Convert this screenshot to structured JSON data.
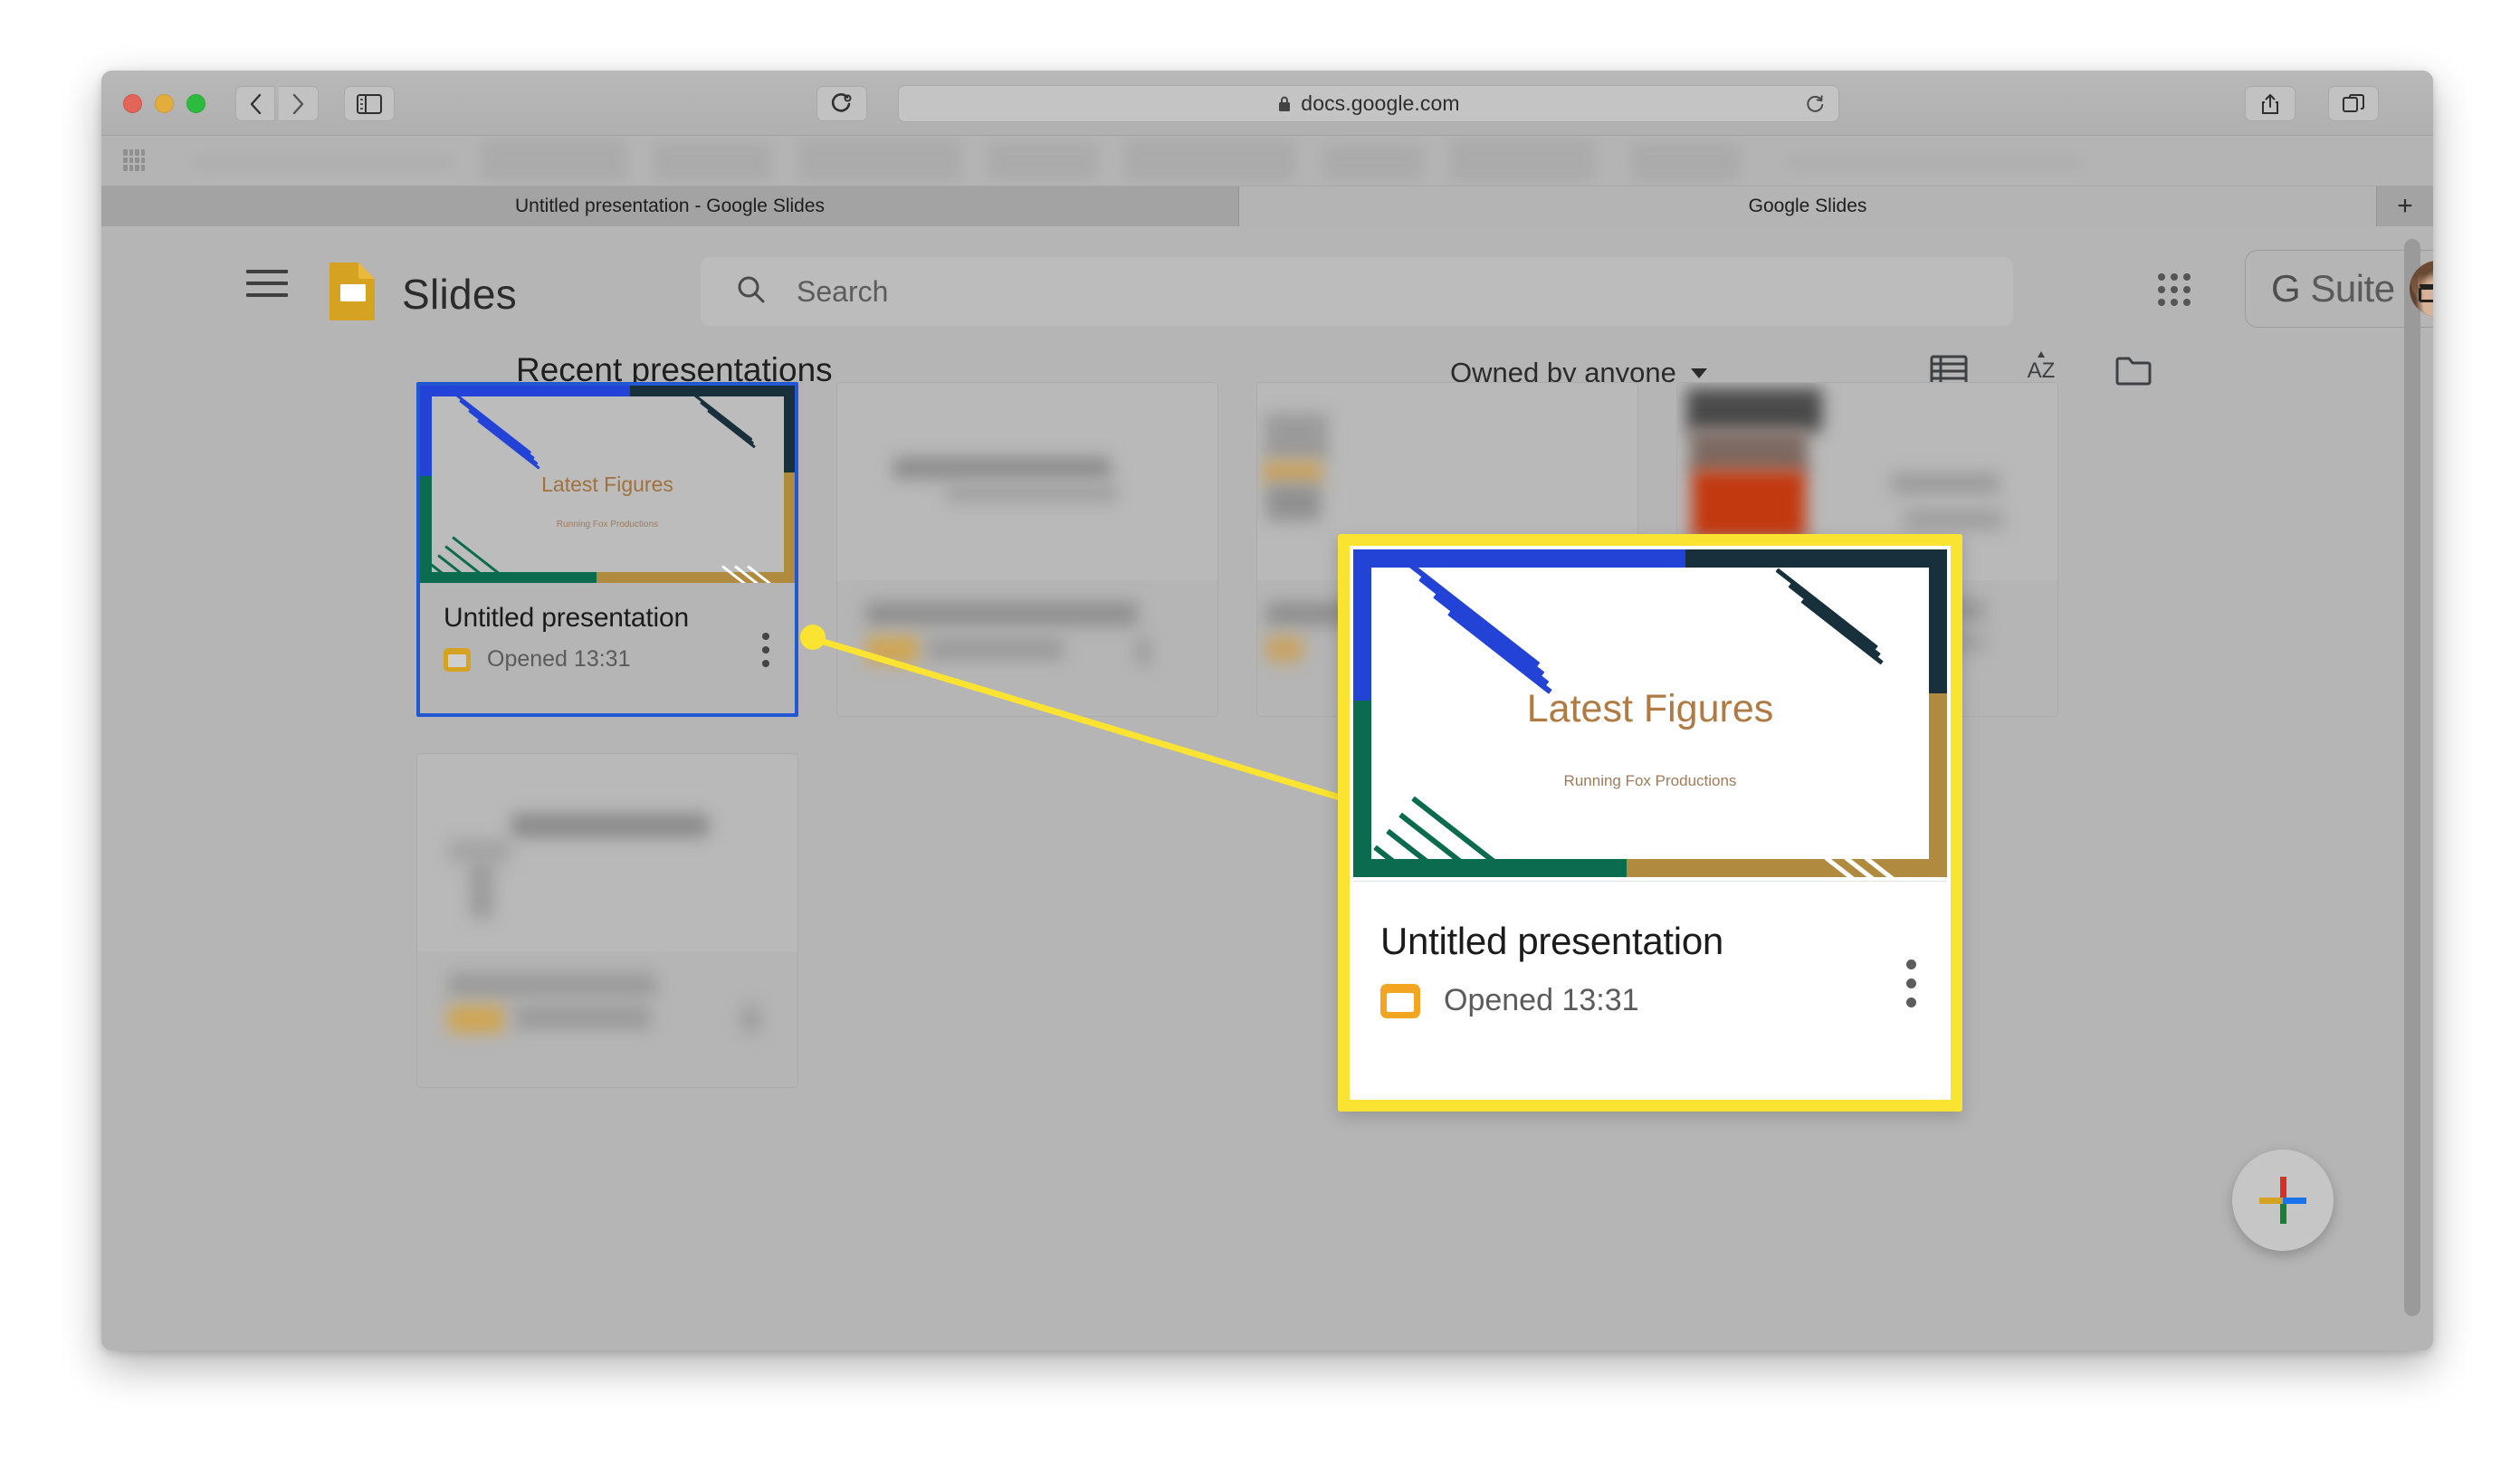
{
  "browser": {
    "url": "docs.google.com",
    "lock_icon": "lock-icon",
    "reload_icon": "reload-icon",
    "back_icon": "chevron-left-icon",
    "forward_icon": "chevron-right-icon",
    "sidebar_icon": "sidebar-toggle-icon",
    "reader_icon": "reader-view-icon",
    "share_icon": "share-icon",
    "tabs_icon": "show-all-tabs-icon",
    "new_tab_label": "+",
    "tabs": [
      {
        "label": "Untitled presentation - Google Slides",
        "active": false
      },
      {
        "label": "Google Slides",
        "active": true
      }
    ]
  },
  "app": {
    "name": "Slides",
    "menu_icon": "hamburger-menu-icon",
    "logo_icon": "google-slides-logo-icon",
    "apps_icon": "google-apps-grid-icon",
    "search": {
      "placeholder": "Search",
      "icon": "search-icon"
    },
    "account": {
      "badge_g": "G",
      "badge_text": "Suite",
      "avatar": "user-avatar"
    }
  },
  "section": {
    "title": "Recent presentations",
    "owner_filter": "Owned by anyone",
    "owner_filter_caret": "chevron-down-icon",
    "tools": [
      {
        "name": "list-view-icon"
      },
      {
        "name": "sort-az-icon"
      },
      {
        "name": "file-picker-folder-icon"
      }
    ]
  },
  "presentations": [
    {
      "title": "Untitled presentation",
      "opened": "Opened 13:31",
      "slide_title": "Latest Figures",
      "slide_subtitle": "Running Fox Productions",
      "selected": true,
      "type_icon": "slides-file-icon",
      "menu_icon": "more-options-kebab-icon"
    },
    {
      "title": "",
      "opened": "",
      "blurred": true
    },
    {
      "title": "",
      "opened": "",
      "blurred": true
    },
    {
      "title": "",
      "opened": "",
      "blurred": true
    },
    {
      "title": "",
      "opened": "",
      "blurred": true
    }
  ],
  "callout": {
    "slide_title": "Latest Figures",
    "slide_subtitle": "Running Fox Productions",
    "card_title": "Untitled presentation",
    "opened": "Opened 13:31",
    "type_icon": "slides-file-icon",
    "menu_icon": "more-options-kebab-icon",
    "highlight_color": "#fbe431",
    "anchor_icon": "callout-anchor-dot"
  },
  "fab": {
    "name": "new-presentation-button",
    "icon": "plus-icon"
  },
  "colors": {
    "highlight": "#fbe431",
    "selection_border": "#1f58d0",
    "slides_yellow": "#f2a521",
    "slide_blue": "#2343d6",
    "slide_green": "#0b6b4f",
    "slide_gold": "#b08a3e",
    "slide_dark": "#17303c",
    "slide_title_text": "#b07a43"
  }
}
